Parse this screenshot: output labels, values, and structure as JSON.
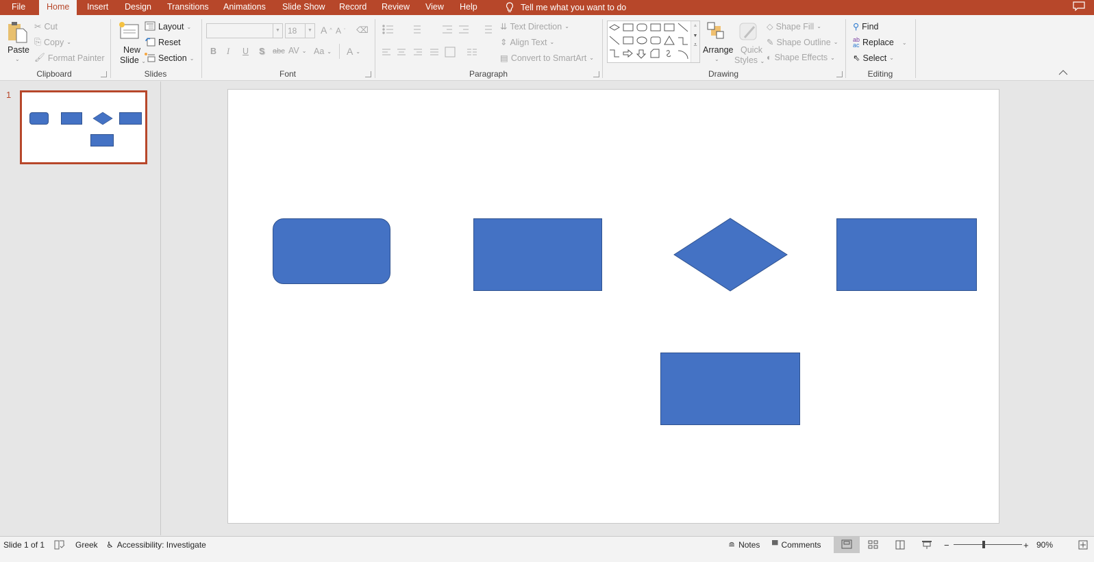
{
  "app": {
    "name": "PowerPoint"
  },
  "tabs": [
    {
      "label": "File",
      "active": false
    },
    {
      "label": "Home",
      "active": true
    },
    {
      "label": "Insert",
      "active": false
    },
    {
      "label": "Design",
      "active": false
    },
    {
      "label": "Transitions",
      "active": false
    },
    {
      "label": "Animations",
      "active": false
    },
    {
      "label": "Slide Show",
      "active": false
    },
    {
      "label": "Record",
      "active": false
    },
    {
      "label": "Review",
      "active": false
    },
    {
      "label": "View",
      "active": false
    },
    {
      "label": "Help",
      "active": false
    }
  ],
  "tellme": {
    "label": "Tell me what you want to do",
    "icon": "lightbulb-icon"
  },
  "ribbon": {
    "clipboard": {
      "label": "Clipboard",
      "paste": "Paste",
      "cut": "Cut",
      "copy": "Copy",
      "format_painter": "Format Painter"
    },
    "slides": {
      "label": "Slides",
      "new_slide_line1": "New",
      "new_slide_line2": "Slide",
      "layout": "Layout",
      "reset": "Reset",
      "section": "Section"
    },
    "font": {
      "label": "Font",
      "font_name": "",
      "font_size": "18",
      "bold": "B",
      "italic": "I",
      "underline": "U",
      "shadow": "S",
      "strike": "abc",
      "spacing": "AV",
      "case": "Aa",
      "color": "A",
      "grow": "A",
      "shrink": "A"
    },
    "paragraph": {
      "label": "Paragraph",
      "text_direction": "Text Direction",
      "align_text": "Align Text",
      "convert_smartart": "Convert to SmartArt"
    },
    "drawing": {
      "label": "Drawing",
      "arrange": "Arrange",
      "quick_styles_line1": "Quick",
      "quick_styles_line2": "Styles",
      "shape_fill": "Shape Fill",
      "shape_outline": "Shape Outline",
      "shape_effects": "Shape Effects"
    },
    "editing": {
      "label": "Editing",
      "find": "Find",
      "replace": "Replace",
      "select": "Select"
    }
  },
  "thumbnails": [
    {
      "number": "1",
      "selected": true
    }
  ],
  "slide": {
    "shape_color": "#4472c4",
    "shape_border": "#2f528f",
    "shapes": [
      {
        "type": "rounded-rectangle"
      },
      {
        "type": "rectangle"
      },
      {
        "type": "diamond"
      },
      {
        "type": "rectangle"
      },
      {
        "type": "rectangle"
      }
    ]
  },
  "status": {
    "slide_info": "Slide 1 of 1",
    "language": "Greek",
    "accessibility": "Accessibility: Investigate",
    "notes": "Notes",
    "comments": "Comments",
    "zoom": "90%",
    "zoom_level_percent": 90
  },
  "colors": {
    "accent": "#b7472a",
    "ribbon_bg": "#f3f3f3",
    "shape_fill": "#4472c4"
  }
}
